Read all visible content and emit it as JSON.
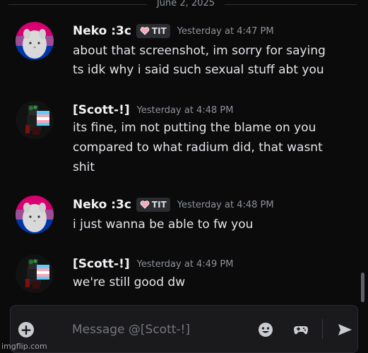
{
  "divider": {
    "date": "June 2, 2025"
  },
  "messages": [
    {
      "username": "Neko :3c",
      "tag": "TIT",
      "timestamp": "Yesterday at 4:47 PM",
      "lines": [
        "about that screenshot, im sorry for saying",
        "ts idk why i said such sexual stuff abt you"
      ]
    },
    {
      "username": "[Scott-!]",
      "tag": "",
      "timestamp": "Yesterday at 4:48 PM",
      "lines": [
        "its fine, im not putting the blame on you",
        "compared to what radium did, that wasnt",
        "shit"
      ]
    },
    {
      "username": "Neko :3c",
      "tag": "TIT",
      "timestamp": "Yesterday at 4:48 PM",
      "lines": [
        "i just wanna be able to fw you"
      ]
    },
    {
      "username": "[Scott-!]",
      "tag": "",
      "timestamp": "Yesterday at 4:49 PM",
      "lines": [
        "we're still good dw"
      ]
    }
  ],
  "composer": {
    "placeholder": "Message @[Scott-!]",
    "icons": [
      "add-icon",
      "emoji-icon",
      "gamepad-icon",
      "send-icon"
    ]
  },
  "watermark": "imgflip.com",
  "colors": {
    "background": "#0b0b0c",
    "username": "#f2f3f5",
    "timestamp": "#8e9297",
    "tag_heart": "#f4a7b9"
  }
}
